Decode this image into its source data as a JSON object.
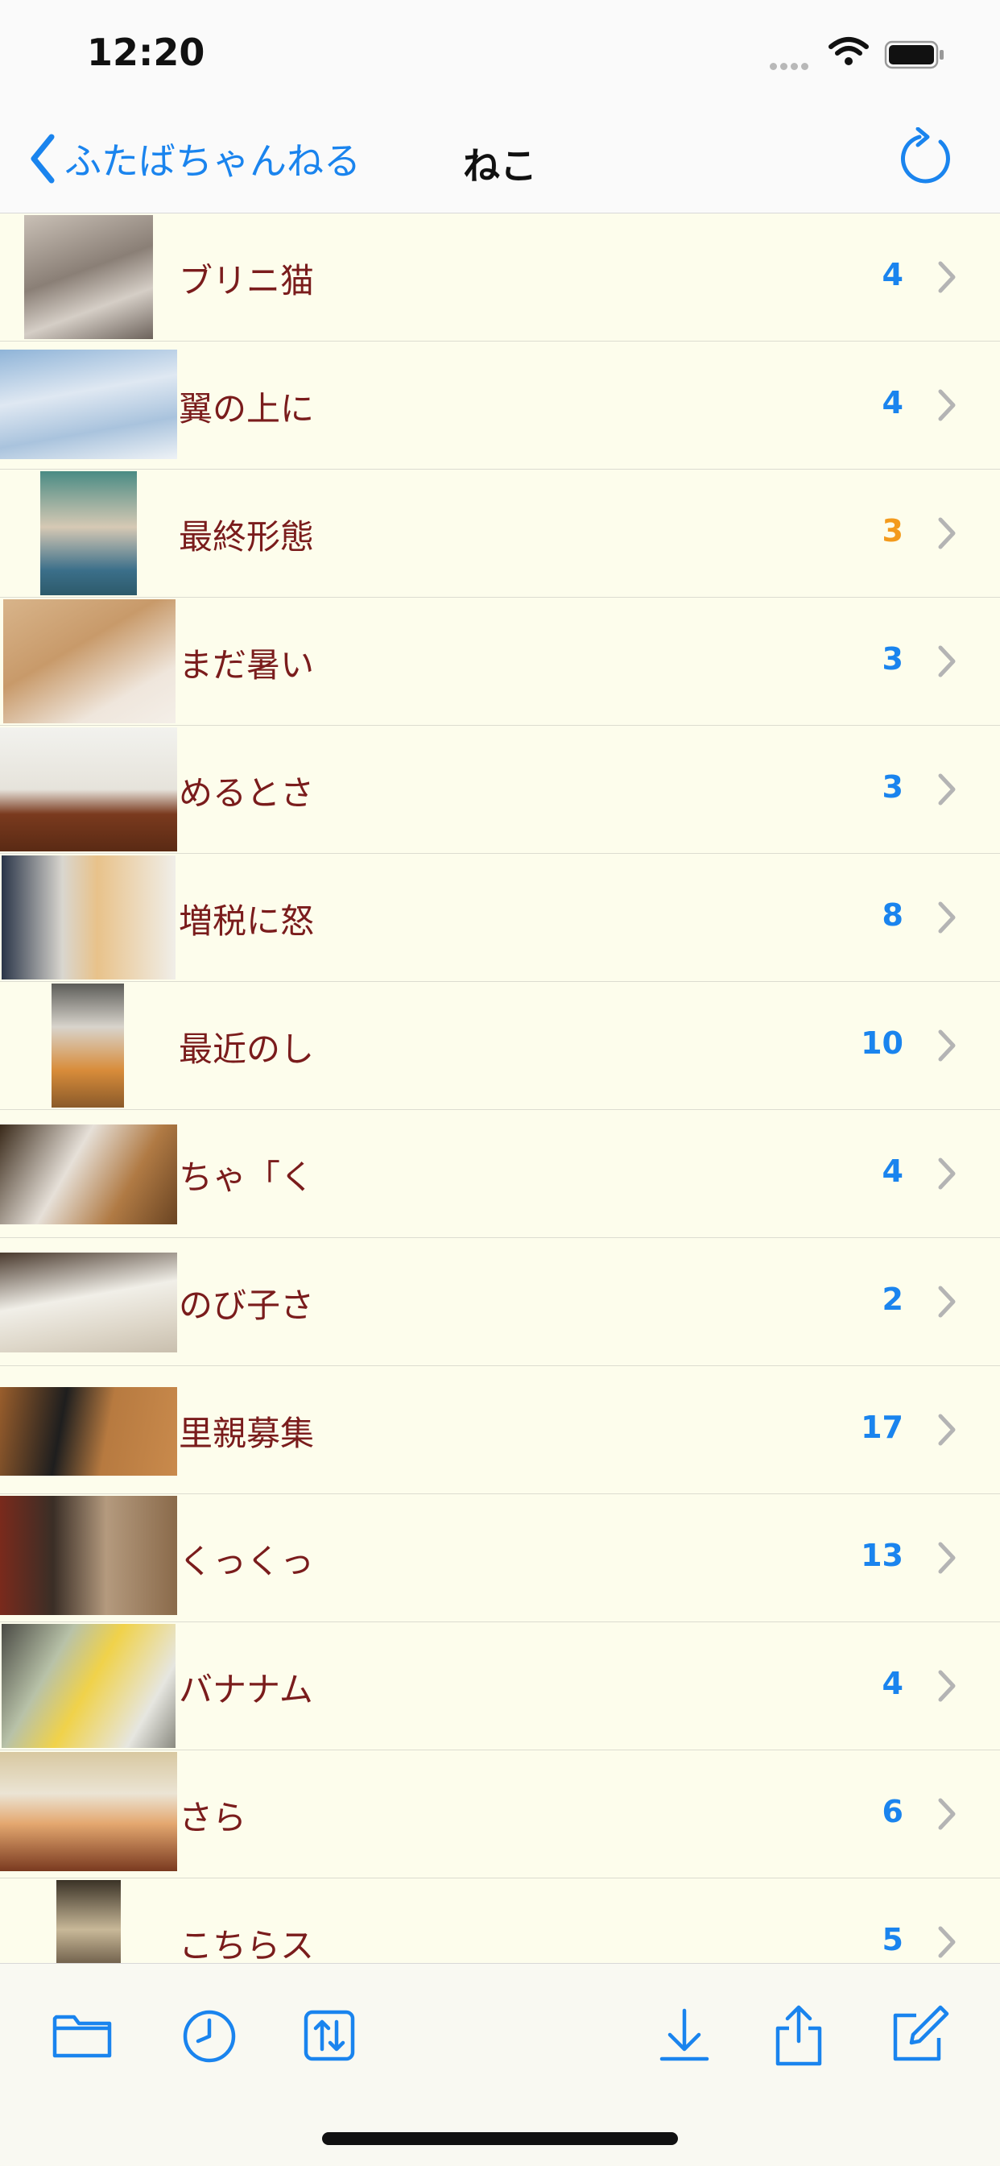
{
  "status_bar": {
    "time": "12:20"
  },
  "nav": {
    "back_label": "ふたばちゃんねる",
    "title": "ねこ"
  },
  "rows": [
    {
      "title": "ブリニ猫",
      "count": "4"
    },
    {
      "title": "翼の上に",
      "count": "4"
    },
    {
      "title": "最終形態",
      "count": "3"
    },
    {
      "title": "まだ暑い",
      "count": "3"
    },
    {
      "title": "めるとさ",
      "count": "3"
    },
    {
      "title": "増税に怒",
      "count": "8"
    },
    {
      "title": "最近のし",
      "count": "10"
    },
    {
      "title": "ちゃ「く",
      "count": "4"
    },
    {
      "title": "のび子さ",
      "count": "2"
    },
    {
      "title": "里親募集",
      "count": "17"
    },
    {
      "title": "くっくっ",
      "count": "13"
    },
    {
      "title": "バナナム",
      "count": "4"
    },
    {
      "title": "さら",
      "count": "6"
    },
    {
      "title": "こちらス",
      "count": "5"
    }
  ],
  "colors": {
    "accent": "#1a84ee",
    "title_text": "#7a1c1c",
    "count_highlight": "#f39a1c",
    "background": "#fdfdec"
  },
  "toolbar_icons": [
    "folder-icon",
    "history-icon",
    "sort-icon",
    "download-icon",
    "share-icon",
    "compose-icon"
  ]
}
